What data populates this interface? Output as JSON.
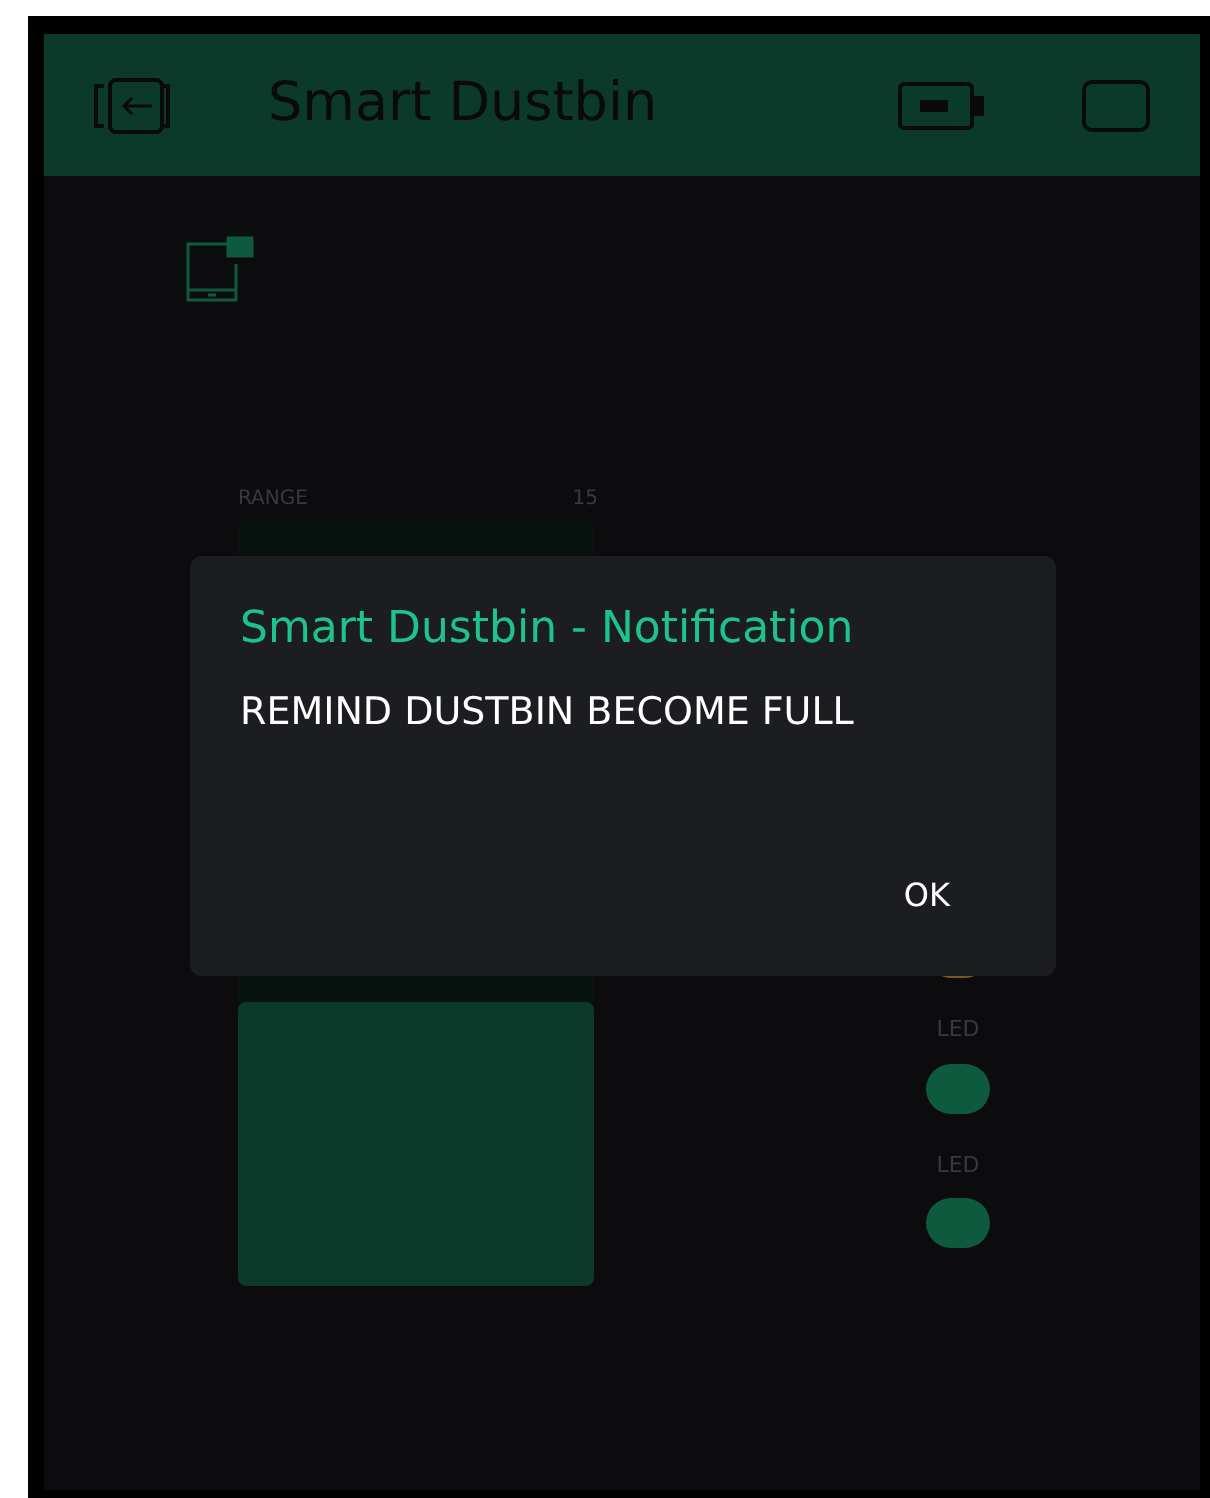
{
  "app_bar": {
    "title": "Smart Dustbin"
  },
  "level_widget": {
    "label": "RANGE",
    "value": "15",
    "level": 0.37
  },
  "leds": [
    {
      "color": "#7a5a14"
    },
    {
      "label": "LED",
      "color": "#0d5a3e"
    },
    {
      "label": "LED",
      "color": "#0d5a3e"
    }
  ],
  "dialog": {
    "title": "Smart Dustbin - Notification",
    "message": "REMIND DUSTBIN BECOME FULL",
    "button": "OK"
  }
}
